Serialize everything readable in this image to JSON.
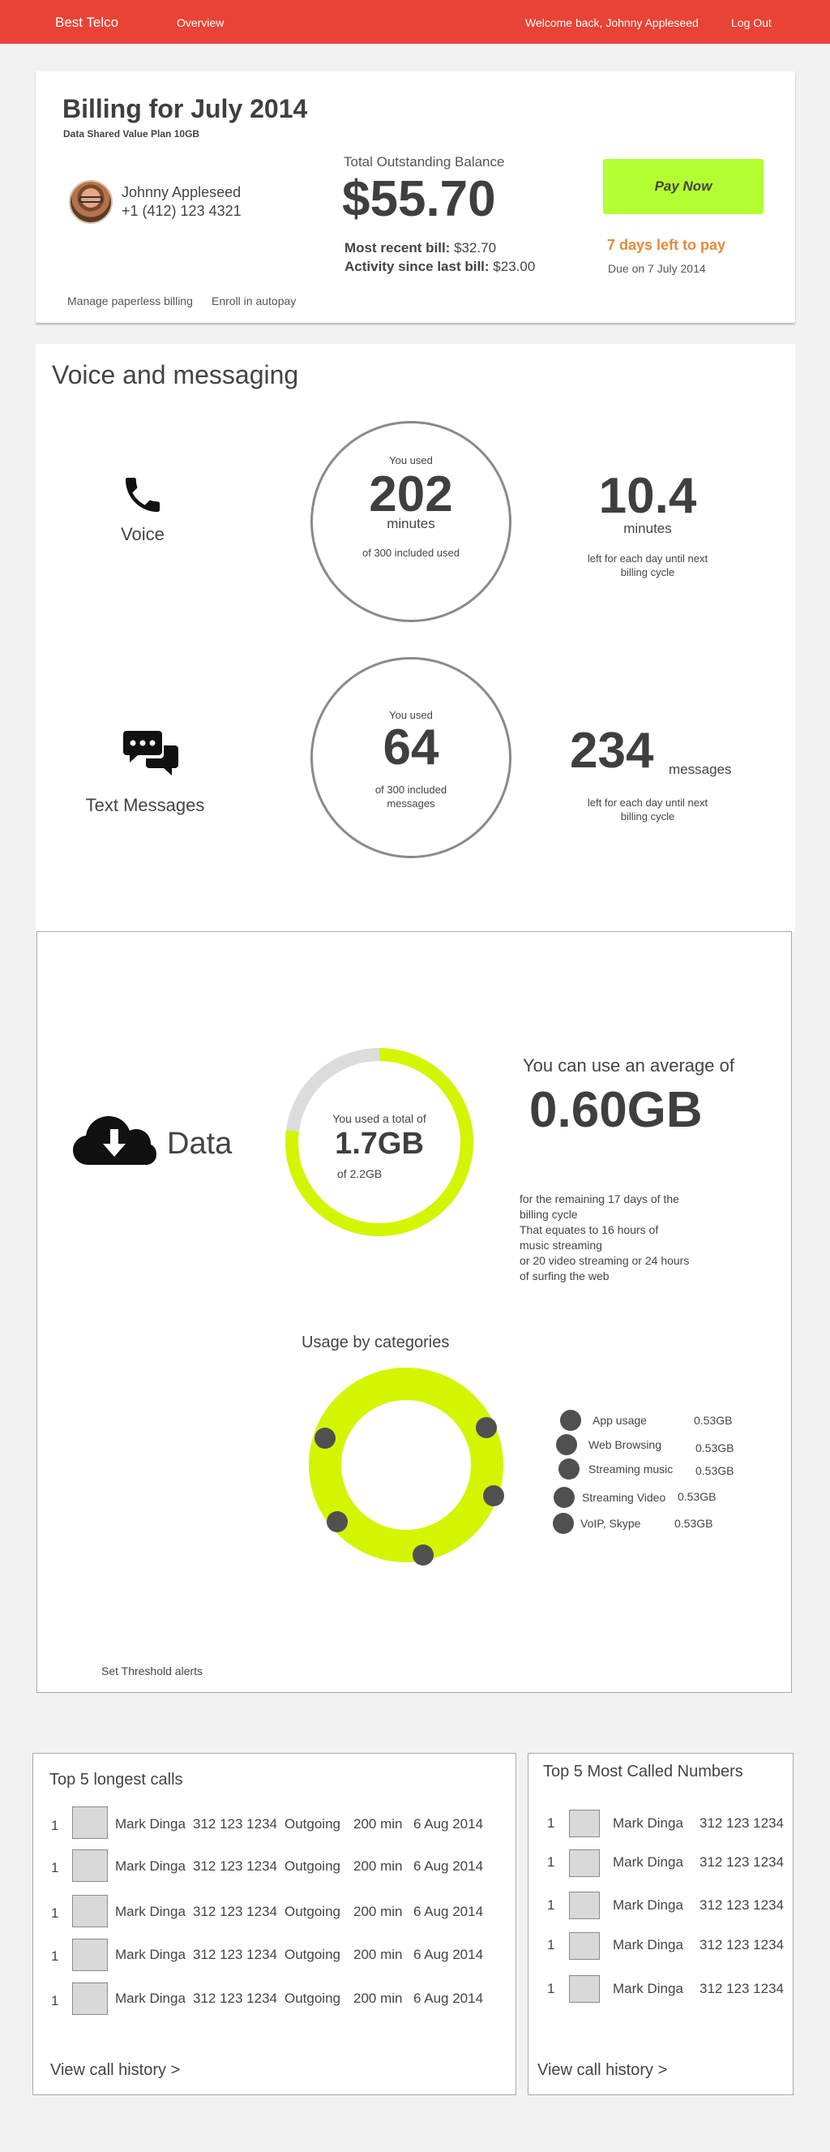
{
  "header": {
    "brand": "Best Telco",
    "nav_overview": "Overview",
    "welcome": "Welcome back, Johnny Appleseed",
    "logout": "Log Out",
    "bg_color": "#e94335"
  },
  "billing": {
    "title": "Billing for July 2014",
    "plan": "Data Shared Value Plan 10GB",
    "user_name": "Johnny Appleseed",
    "user_phone": "+1 (412) 123 4321",
    "balance_label": "Total Outstanding Balance",
    "balance_amount": "$55.70",
    "recent_bill_label": "Most recent bill:",
    "recent_bill_value": "$32.70",
    "activity_label": "Activity since last bill:",
    "activity_value": "$23.00",
    "pay_now": "Pay Now",
    "days_left": "7 days left to pay",
    "due_on": "Due on 7 July 2014",
    "link_paperless": "Manage paperless billing",
    "link_autopay": "Enroll in autopay",
    "pay_color": "#b4ff32",
    "warning_color": "#e58a3b"
  },
  "voice_messaging": {
    "title": "Voice and messaging",
    "voice": {
      "label": "Voice",
      "icon": "phone-icon",
      "used_caption": "You used",
      "used_value": "202",
      "used_unit": "minutes",
      "included": "of 300 included used",
      "daily_value": "10.4",
      "daily_unit": "minutes",
      "daily_caption": "left for each day until next billing cycle"
    },
    "text": {
      "label": "Text Messages",
      "icon": "chat-bubbles-icon",
      "used_caption": "You used",
      "used_value": "64",
      "included": "of 300 included messages",
      "daily_value": "234",
      "daily_unit": "messages",
      "daily_caption": "left for each day until next billing cycle"
    }
  },
  "data_usage": {
    "label": "Data",
    "icon": "cloud-download-icon",
    "used_caption": "You used a total of",
    "used_value": "1.7GB",
    "used_of": "of 2.2GB",
    "used_fraction": 0.77,
    "gauge_color": "#d4f500",
    "avg_heading": "You can use an average of",
    "avg_value": "0.60GB",
    "avg_lines": [
      "for the remaining 17 days of the",
      "billing cycle",
      "That equates to 16 hours of",
      "music streaming",
      "or 20 video streaming or 24 hours",
      "of surfing the web"
    ],
    "categories_title": "Usage by categories",
    "categories": [
      {
        "name": "App usage",
        "value": "0.53GB"
      },
      {
        "name": "Web Browsing",
        "value": "0.53GB"
      },
      {
        "name": "Streaming music",
        "value": "0.53GB"
      },
      {
        "name": "Streaming Video",
        "value": "0.53GB"
      },
      {
        "name": "VoIP, Skype",
        "value": "0.53GB"
      }
    ],
    "threshold_link": "Set Threshold alerts"
  },
  "longest_calls": {
    "title": "Top 5 longest calls",
    "rows": [
      {
        "rank": "1",
        "name": "Mark Dinga",
        "number": "312 123 1234",
        "direction": "Outgoing",
        "duration": "200 min",
        "date": "6 Aug 2014"
      },
      {
        "rank": "1",
        "name": "Mark Dinga",
        "number": "312 123 1234",
        "direction": "Outgoing",
        "duration": "200 min",
        "date": "6 Aug 2014"
      },
      {
        "rank": "1",
        "name": "Mark Dinga",
        "number": "312 123 1234",
        "direction": "Outgoing",
        "duration": "200 min",
        "date": "6 Aug 2014"
      },
      {
        "rank": "1",
        "name": "Mark Dinga",
        "number": "312 123 1234",
        "direction": "Outgoing",
        "duration": "200 min",
        "date": "6 Aug 2014"
      },
      {
        "rank": "1",
        "name": "Mark Dinga",
        "number": "312 123 1234",
        "direction": "Outgoing",
        "duration": "200 min",
        "date": "6 Aug 2014"
      }
    ],
    "view_history": "View call history >"
  },
  "most_called": {
    "title": "Top 5 Most Called Numbers",
    "rows": [
      {
        "rank": "1",
        "name": "Mark Dinga",
        "number": "312 123 1234"
      },
      {
        "rank": "1",
        "name": "Mark Dinga",
        "number": "312 123 1234"
      },
      {
        "rank": "1",
        "name": "Mark Dinga",
        "number": "312 123 1234"
      },
      {
        "rank": "1",
        "name": "Mark Dinga",
        "number": "312 123 1234"
      },
      {
        "rank": "1",
        "name": "Mark Dinga",
        "number": "312 123 1234"
      }
    ],
    "view_history": "View call history >"
  }
}
